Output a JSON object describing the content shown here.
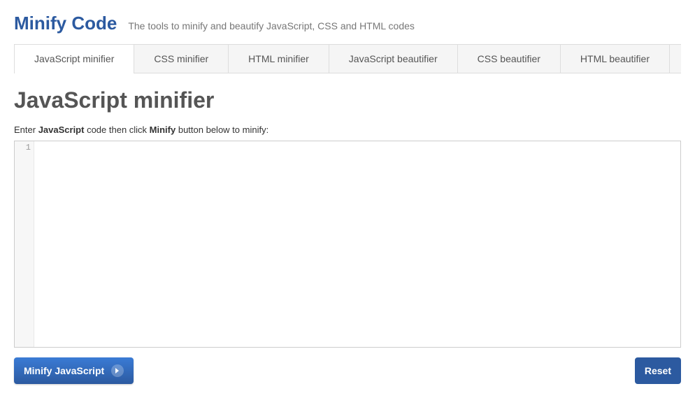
{
  "header": {
    "site_title": "Minify Code",
    "tagline": "The tools to minify and beautify JavaScript, CSS and HTML codes"
  },
  "tabs": [
    {
      "label": "JavaScript minifier",
      "active": true
    },
    {
      "label": "CSS minifier",
      "active": false
    },
    {
      "label": "HTML minifier",
      "active": false
    },
    {
      "label": "JavaScript beautifier",
      "active": false
    },
    {
      "label": "CSS beautifier",
      "active": false
    },
    {
      "label": "HTML beautifier",
      "active": false
    }
  ],
  "page": {
    "title": "JavaScript minifier",
    "instruction_prefix": "Enter ",
    "instruction_lang": "JavaScript",
    "instruction_mid": " code then click ",
    "instruction_btn": "Minify",
    "instruction_suffix": " button below to minify:"
  },
  "editor": {
    "line_number": "1",
    "value": ""
  },
  "buttons": {
    "minify": "Minify JavaScript",
    "reset": "Reset"
  }
}
